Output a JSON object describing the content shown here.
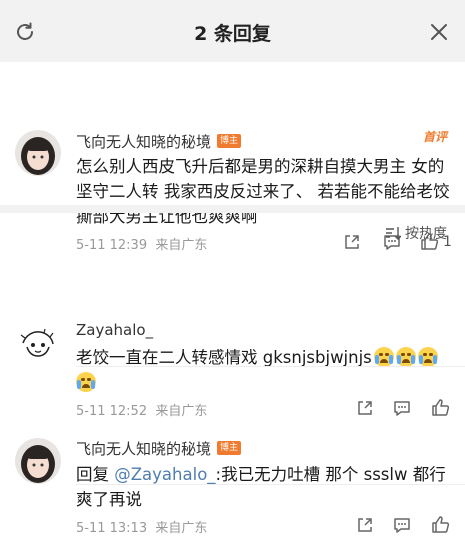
{
  "header": {
    "title": "2 条回复",
    "refresh_icon": "refresh-icon",
    "close_icon": "close-icon"
  },
  "main_comment": {
    "username": "飞向无人知晓的秘境",
    "badge": "博主",
    "first_label": "首评",
    "text": "怎么别人西皮飞升后都是男的深耕自摸大男主 女的坚守二人转 我家西皮反过来了、 若若能不能给老饺撕部大男主让他也爽爽啊",
    "time": "5-11 12:39",
    "location": "来自广东",
    "like_count": "1"
  },
  "sort": {
    "label": "按热度"
  },
  "replies": [
    {
      "username": "Zayahalo_",
      "text": "老饺一直在二人转感情戏 gksnjsbjwjnjs",
      "time": "5-11 12:52",
      "location": "来自广东"
    },
    {
      "username": "飞向无人知晓的秘境",
      "badge": "博主",
      "prefix": "回复 ",
      "mention": "@Zayahalo_",
      "text": ":我已无力吐槽 那个 ssslw 都行 爽了再说",
      "time": "5-11 13:13",
      "location": "来自广东"
    }
  ],
  "colors": {
    "accent_orange": "#f07b2e",
    "mention_blue": "#507daf",
    "header_bg": "#f2f2f2"
  }
}
